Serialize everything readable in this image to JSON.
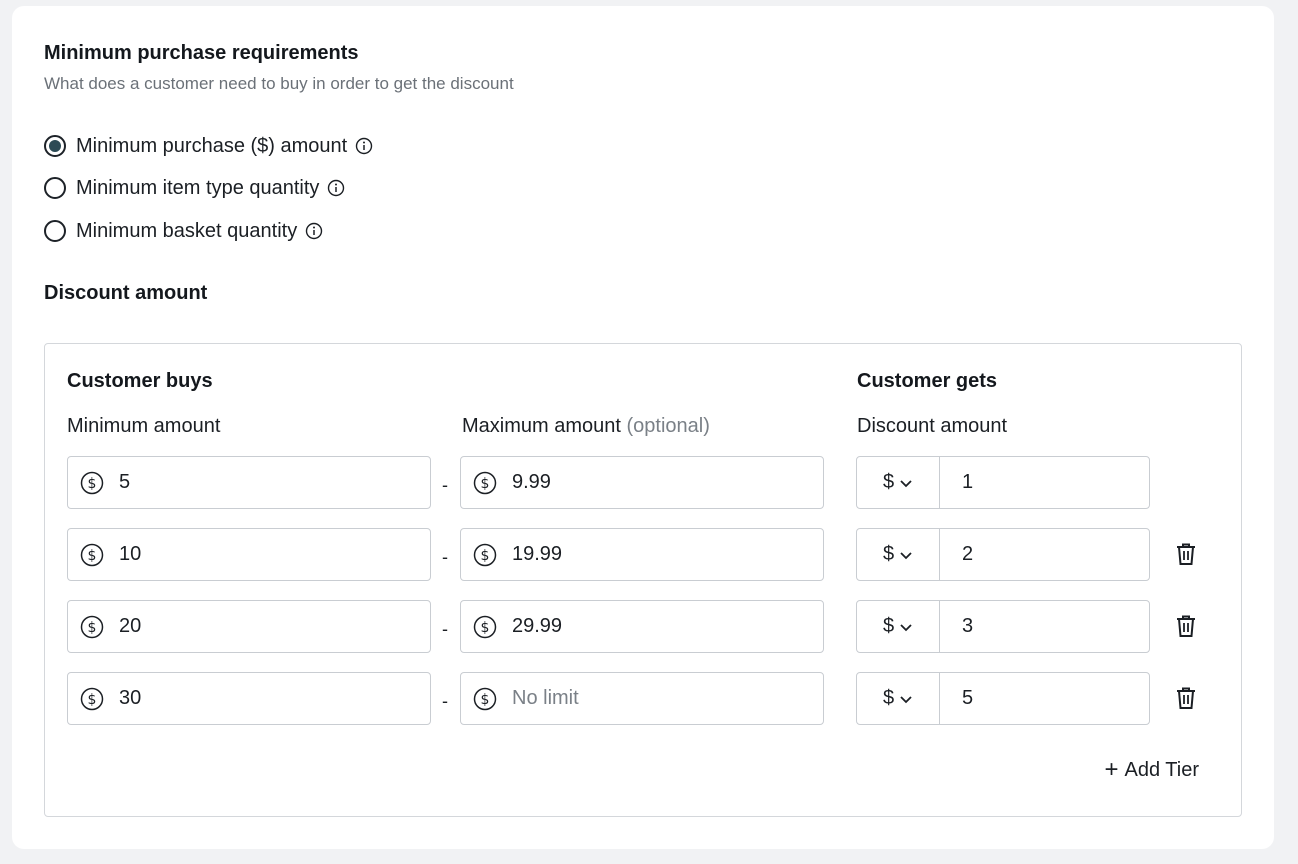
{
  "requirements": {
    "title": "Minimum purchase requirements",
    "subtitle": "What does a customer need to buy in order to get the discount",
    "options": [
      {
        "label": "Minimum purchase ($) amount",
        "selected": true,
        "icon": "info-icon"
      },
      {
        "label": "Minimum item type quantity",
        "selected": false,
        "icon": "info-icon"
      },
      {
        "label": "Minimum basket quantity",
        "selected": false,
        "icon": "info-icon"
      }
    ]
  },
  "discount": {
    "title": "Discount amount",
    "customer_buys_heading": "Customer buys",
    "customer_gets_heading": "Customer gets",
    "min_label": "Minimum amount",
    "max_label": "Maximum amount",
    "max_optional": "(optional)",
    "discount_label": "Discount amount",
    "dash": "-",
    "tiers": [
      {
        "min": "5",
        "max": "9.99",
        "currency": "$",
        "amount": "1",
        "deletable": false
      },
      {
        "min": "10",
        "max": "19.99",
        "currency": "$",
        "amount": "2",
        "deletable": true
      },
      {
        "min": "20",
        "max": "29.99",
        "currency": "$",
        "amount": "3",
        "deletable": true
      },
      {
        "min": "30",
        "max": "",
        "max_placeholder": "No limit",
        "currency": "$",
        "amount": "5",
        "deletable": true
      }
    ],
    "add_tier_label": "Add Tier",
    "add_tier_plus": "+"
  },
  "colors": {
    "radio_selected": "#2c4a55",
    "muted_text": "#6b7178",
    "border": "#c9cdd2"
  }
}
